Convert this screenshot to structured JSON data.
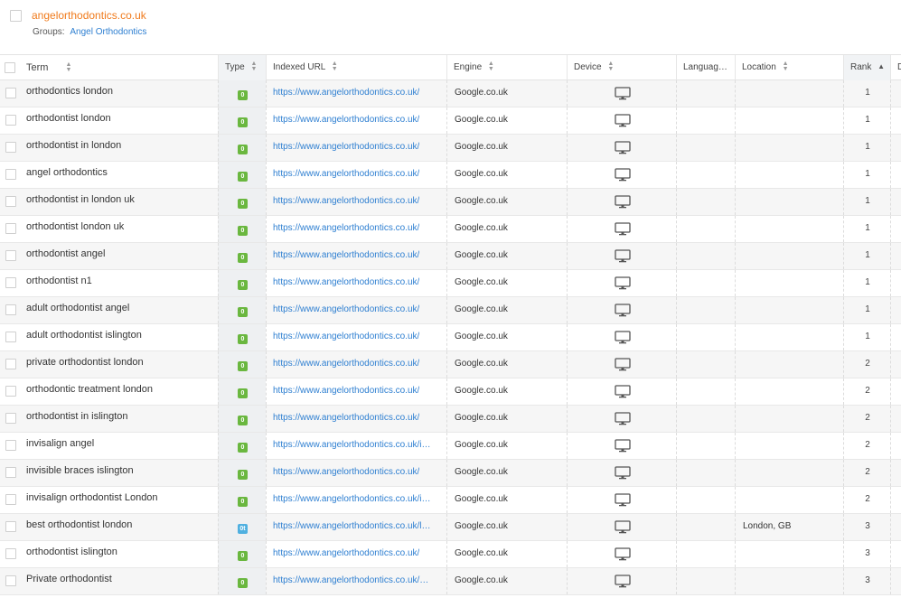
{
  "header": {
    "site": "angelorthodontics.co.uk",
    "groups_label": "Groups:",
    "groups_value": "Angel Orthodontics"
  },
  "columns": {
    "term": "Term",
    "type": "Type",
    "url": "Indexed URL",
    "engine": "Engine",
    "device": "Device",
    "language": "Languag…",
    "location": "Location",
    "rank": "Rank",
    "d": "D"
  },
  "sort": {
    "column": "rank",
    "direction": "ascending"
  },
  "icons": {
    "device": "desktop-monitor-icon",
    "sort": "sort-arrows-icon"
  },
  "colors": {
    "site": "#f07b1d",
    "link": "#2e7fd1",
    "organic": "#6ab73f",
    "local": "#4fb0e0"
  },
  "rows": [
    {
      "term": "orthodontics london",
      "type": "organic",
      "type_glyph": "0",
      "url": "https://www.angelorthodontics.co.uk/",
      "engine": "Google.co.uk",
      "device": "desktop",
      "location": "",
      "rank": "1"
    },
    {
      "term": "orthodontist london",
      "type": "organic",
      "type_glyph": "0",
      "url": "https://www.angelorthodontics.co.uk/",
      "engine": "Google.co.uk",
      "device": "desktop",
      "location": "",
      "rank": "1"
    },
    {
      "term": "orthodontist in london",
      "type": "organic",
      "type_glyph": "0",
      "url": "https://www.angelorthodontics.co.uk/",
      "engine": "Google.co.uk",
      "device": "desktop",
      "location": "",
      "rank": "1"
    },
    {
      "term": "angel orthodontics",
      "type": "organic",
      "type_glyph": "0",
      "url": "https://www.angelorthodontics.co.uk/",
      "engine": "Google.co.uk",
      "device": "desktop",
      "location": "",
      "rank": "1"
    },
    {
      "term": "orthodontist in london uk",
      "type": "organic",
      "type_glyph": "0",
      "url": "https://www.angelorthodontics.co.uk/",
      "engine": "Google.co.uk",
      "device": "desktop",
      "location": "",
      "rank": "1"
    },
    {
      "term": "orthodontist london uk",
      "type": "organic",
      "type_glyph": "0",
      "url": "https://www.angelorthodontics.co.uk/",
      "engine": "Google.co.uk",
      "device": "desktop",
      "location": "",
      "rank": "1"
    },
    {
      "term": "orthodontist angel",
      "type": "organic",
      "type_glyph": "0",
      "url": "https://www.angelorthodontics.co.uk/",
      "engine": "Google.co.uk",
      "device": "desktop",
      "location": "",
      "rank": "1"
    },
    {
      "term": "orthodontist n1",
      "type": "organic",
      "type_glyph": "0",
      "url": "https://www.angelorthodontics.co.uk/",
      "engine": "Google.co.uk",
      "device": "desktop",
      "location": "",
      "rank": "1"
    },
    {
      "term": "adult orthodontist angel",
      "type": "organic",
      "type_glyph": "0",
      "url": "https://www.angelorthodontics.co.uk/",
      "engine": "Google.co.uk",
      "device": "desktop",
      "location": "",
      "rank": "1"
    },
    {
      "term": "adult orthodontist islington",
      "type": "organic",
      "type_glyph": "0",
      "url": "https://www.angelorthodontics.co.uk/",
      "engine": "Google.co.uk",
      "device": "desktop",
      "location": "",
      "rank": "1"
    },
    {
      "term": "private orthodontist london",
      "type": "organic",
      "type_glyph": "0",
      "url": "https://www.angelorthodontics.co.uk/",
      "engine": "Google.co.uk",
      "device": "desktop",
      "location": "",
      "rank": "2"
    },
    {
      "term": "orthodontic treatment london",
      "type": "organic",
      "type_glyph": "0",
      "url": "https://www.angelorthodontics.co.uk/",
      "engine": "Google.co.uk",
      "device": "desktop",
      "location": "",
      "rank": "2"
    },
    {
      "term": "orthodontist in islington",
      "type": "organic",
      "type_glyph": "0",
      "url": "https://www.angelorthodontics.co.uk/",
      "engine": "Google.co.uk",
      "device": "desktop",
      "location": "",
      "rank": "2"
    },
    {
      "term": "invisalign angel",
      "type": "organic",
      "type_glyph": "0",
      "url": "https://www.angelorthodontics.co.uk/i…",
      "engine": "Google.co.uk",
      "device": "desktop",
      "location": "",
      "rank": "2"
    },
    {
      "term": "invisible braces islington",
      "type": "organic",
      "type_glyph": "0",
      "url": "https://www.angelorthodontics.co.uk/",
      "engine": "Google.co.uk",
      "device": "desktop",
      "location": "",
      "rank": "2"
    },
    {
      "term": "invisalign orthodontist London",
      "type": "organic",
      "type_glyph": "0",
      "url": "https://www.angelorthodontics.co.uk/i…",
      "engine": "Google.co.uk",
      "device": "desktop",
      "location": "",
      "rank": "2"
    },
    {
      "term": "best orthodontist london",
      "type": "local",
      "type_glyph": "0t",
      "url": "https://www.angelorthodontics.co.uk/l…",
      "engine": "Google.co.uk",
      "device": "desktop",
      "location": "London, GB",
      "rank": "3"
    },
    {
      "term": "orthodontist islington",
      "type": "organic",
      "type_glyph": "0",
      "url": "https://www.angelorthodontics.co.uk/",
      "engine": "Google.co.uk",
      "device": "desktop",
      "location": "",
      "rank": "3"
    },
    {
      "term": "Private orthodontist",
      "type": "organic",
      "type_glyph": "0",
      "url": "https://www.angelorthodontics.co.uk/…",
      "engine": "Google.co.uk",
      "device": "desktop",
      "location": "",
      "rank": "3"
    }
  ]
}
